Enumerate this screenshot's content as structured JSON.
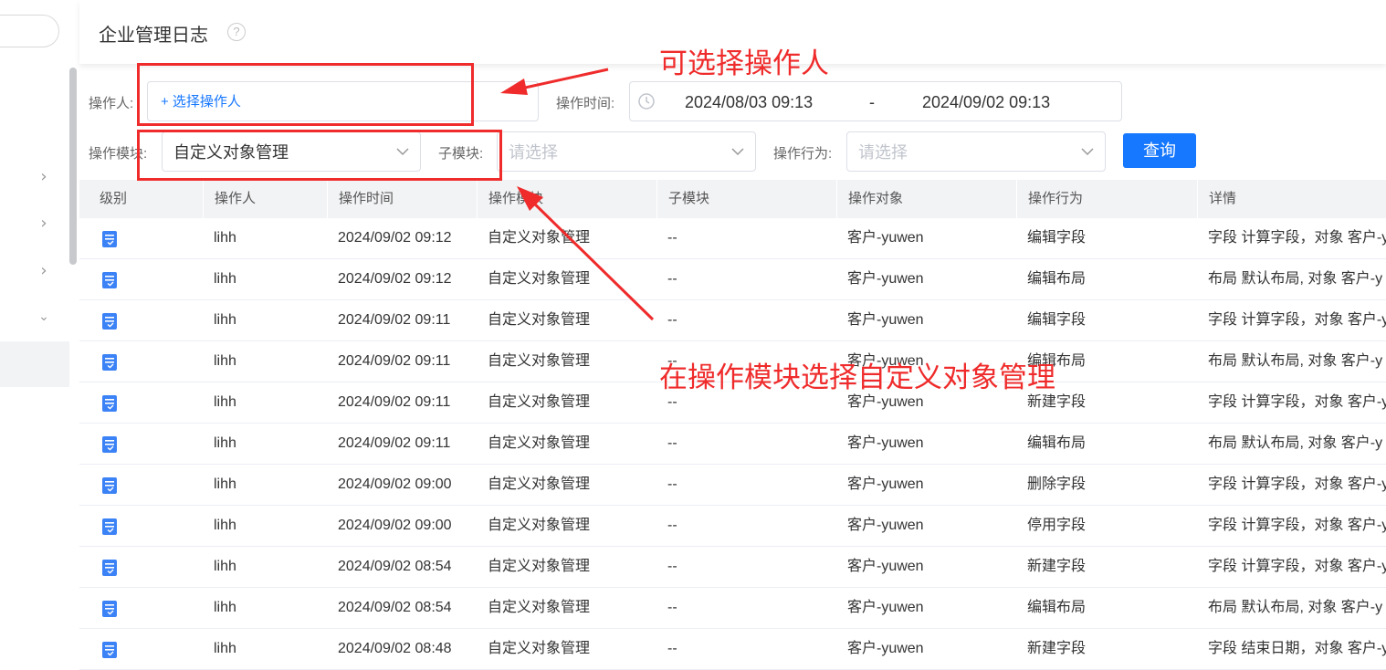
{
  "header": {
    "title": "企业管理日志",
    "help_icon": "question-circle-icon"
  },
  "sidebar": {
    "icons": [
      "chevron-right-icon",
      "chevron-right-icon",
      "chevron-right-icon",
      "chevron-down-icon"
    ]
  },
  "filters": {
    "operator_label": "操作人:",
    "operator_link": "+ 选择操作人",
    "time_label": "操作时间:",
    "time_start": "2024/08/03 09:13",
    "time_sep": "-",
    "time_end": "2024/09/02 09:13",
    "module_label": "操作模块:",
    "module_value": "自定义对象管理",
    "submodule_label": "子模块:",
    "submodule_placeholder": "请选择",
    "action_label": "操作行为:",
    "action_placeholder": "请选择",
    "query_button": "查询"
  },
  "table": {
    "columns": [
      "级别",
      "操作人",
      "操作时间",
      "操作模块",
      "子模块",
      "操作对象",
      "操作行为",
      "详情"
    ],
    "rows": [
      [
        "lihh",
        "2024/09/02 09:12",
        "自定义对象管理",
        "--",
        "客户-yuwen",
        "编辑字段",
        "字段 计算字段，对象 客户-y"
      ],
      [
        "lihh",
        "2024/09/02 09:12",
        "自定义对象管理",
        "--",
        "客户-yuwen",
        "编辑布局",
        "布局 默认布局, 对象 客户-y"
      ],
      [
        "lihh",
        "2024/09/02 09:11",
        "自定义对象管理",
        "--",
        "客户-yuwen",
        "编辑字段",
        "字段 计算字段，对象 客户-y"
      ],
      [
        "lihh",
        "2024/09/02 09:11",
        "自定义对象管理",
        "--",
        "客户-yuwen",
        "编辑布局",
        "布局 默认布局, 对象 客户-y"
      ],
      [
        "lihh",
        "2024/09/02 09:11",
        "自定义对象管理",
        "--",
        "客户-yuwen",
        "新建字段",
        "字段 计算字段，对象 客户-y"
      ],
      [
        "lihh",
        "2024/09/02 09:11",
        "自定义对象管理",
        "--",
        "客户-yuwen",
        "编辑布局",
        "布局 默认布局, 对象 客户-y"
      ],
      [
        "lihh",
        "2024/09/02 09:00",
        "自定义对象管理",
        "--",
        "客户-yuwen",
        "删除字段",
        "字段 计算字段，对象 客户-y"
      ],
      [
        "lihh",
        "2024/09/02 09:00",
        "自定义对象管理",
        "--",
        "客户-yuwen",
        "停用字段",
        "字段 计算字段，对象 客户-y"
      ],
      [
        "lihh",
        "2024/09/02 08:54",
        "自定义对象管理",
        "--",
        "客户-yuwen",
        "新建字段",
        "字段 计算字段，对象 客户-y"
      ],
      [
        "lihh",
        "2024/09/02 08:54",
        "自定义对象管理",
        "--",
        "客户-yuwen",
        "编辑布局",
        "布局 默认布局, 对象 客户-y"
      ],
      [
        "lihh",
        "2024/09/02 08:48",
        "自定义对象管理",
        "--",
        "客户-yuwen",
        "新建字段",
        "字段 结束日期，对象 客户-y"
      ]
    ]
  },
  "annotations": {
    "top_text": "可选择操作人",
    "bottom_text": "在操作模块选择自定义对象管理",
    "color": "#ef2b2b"
  },
  "colors": {
    "primary": "#1677ff",
    "annotation": "#ef2b2b",
    "header_bg": "#f2f3f5"
  }
}
